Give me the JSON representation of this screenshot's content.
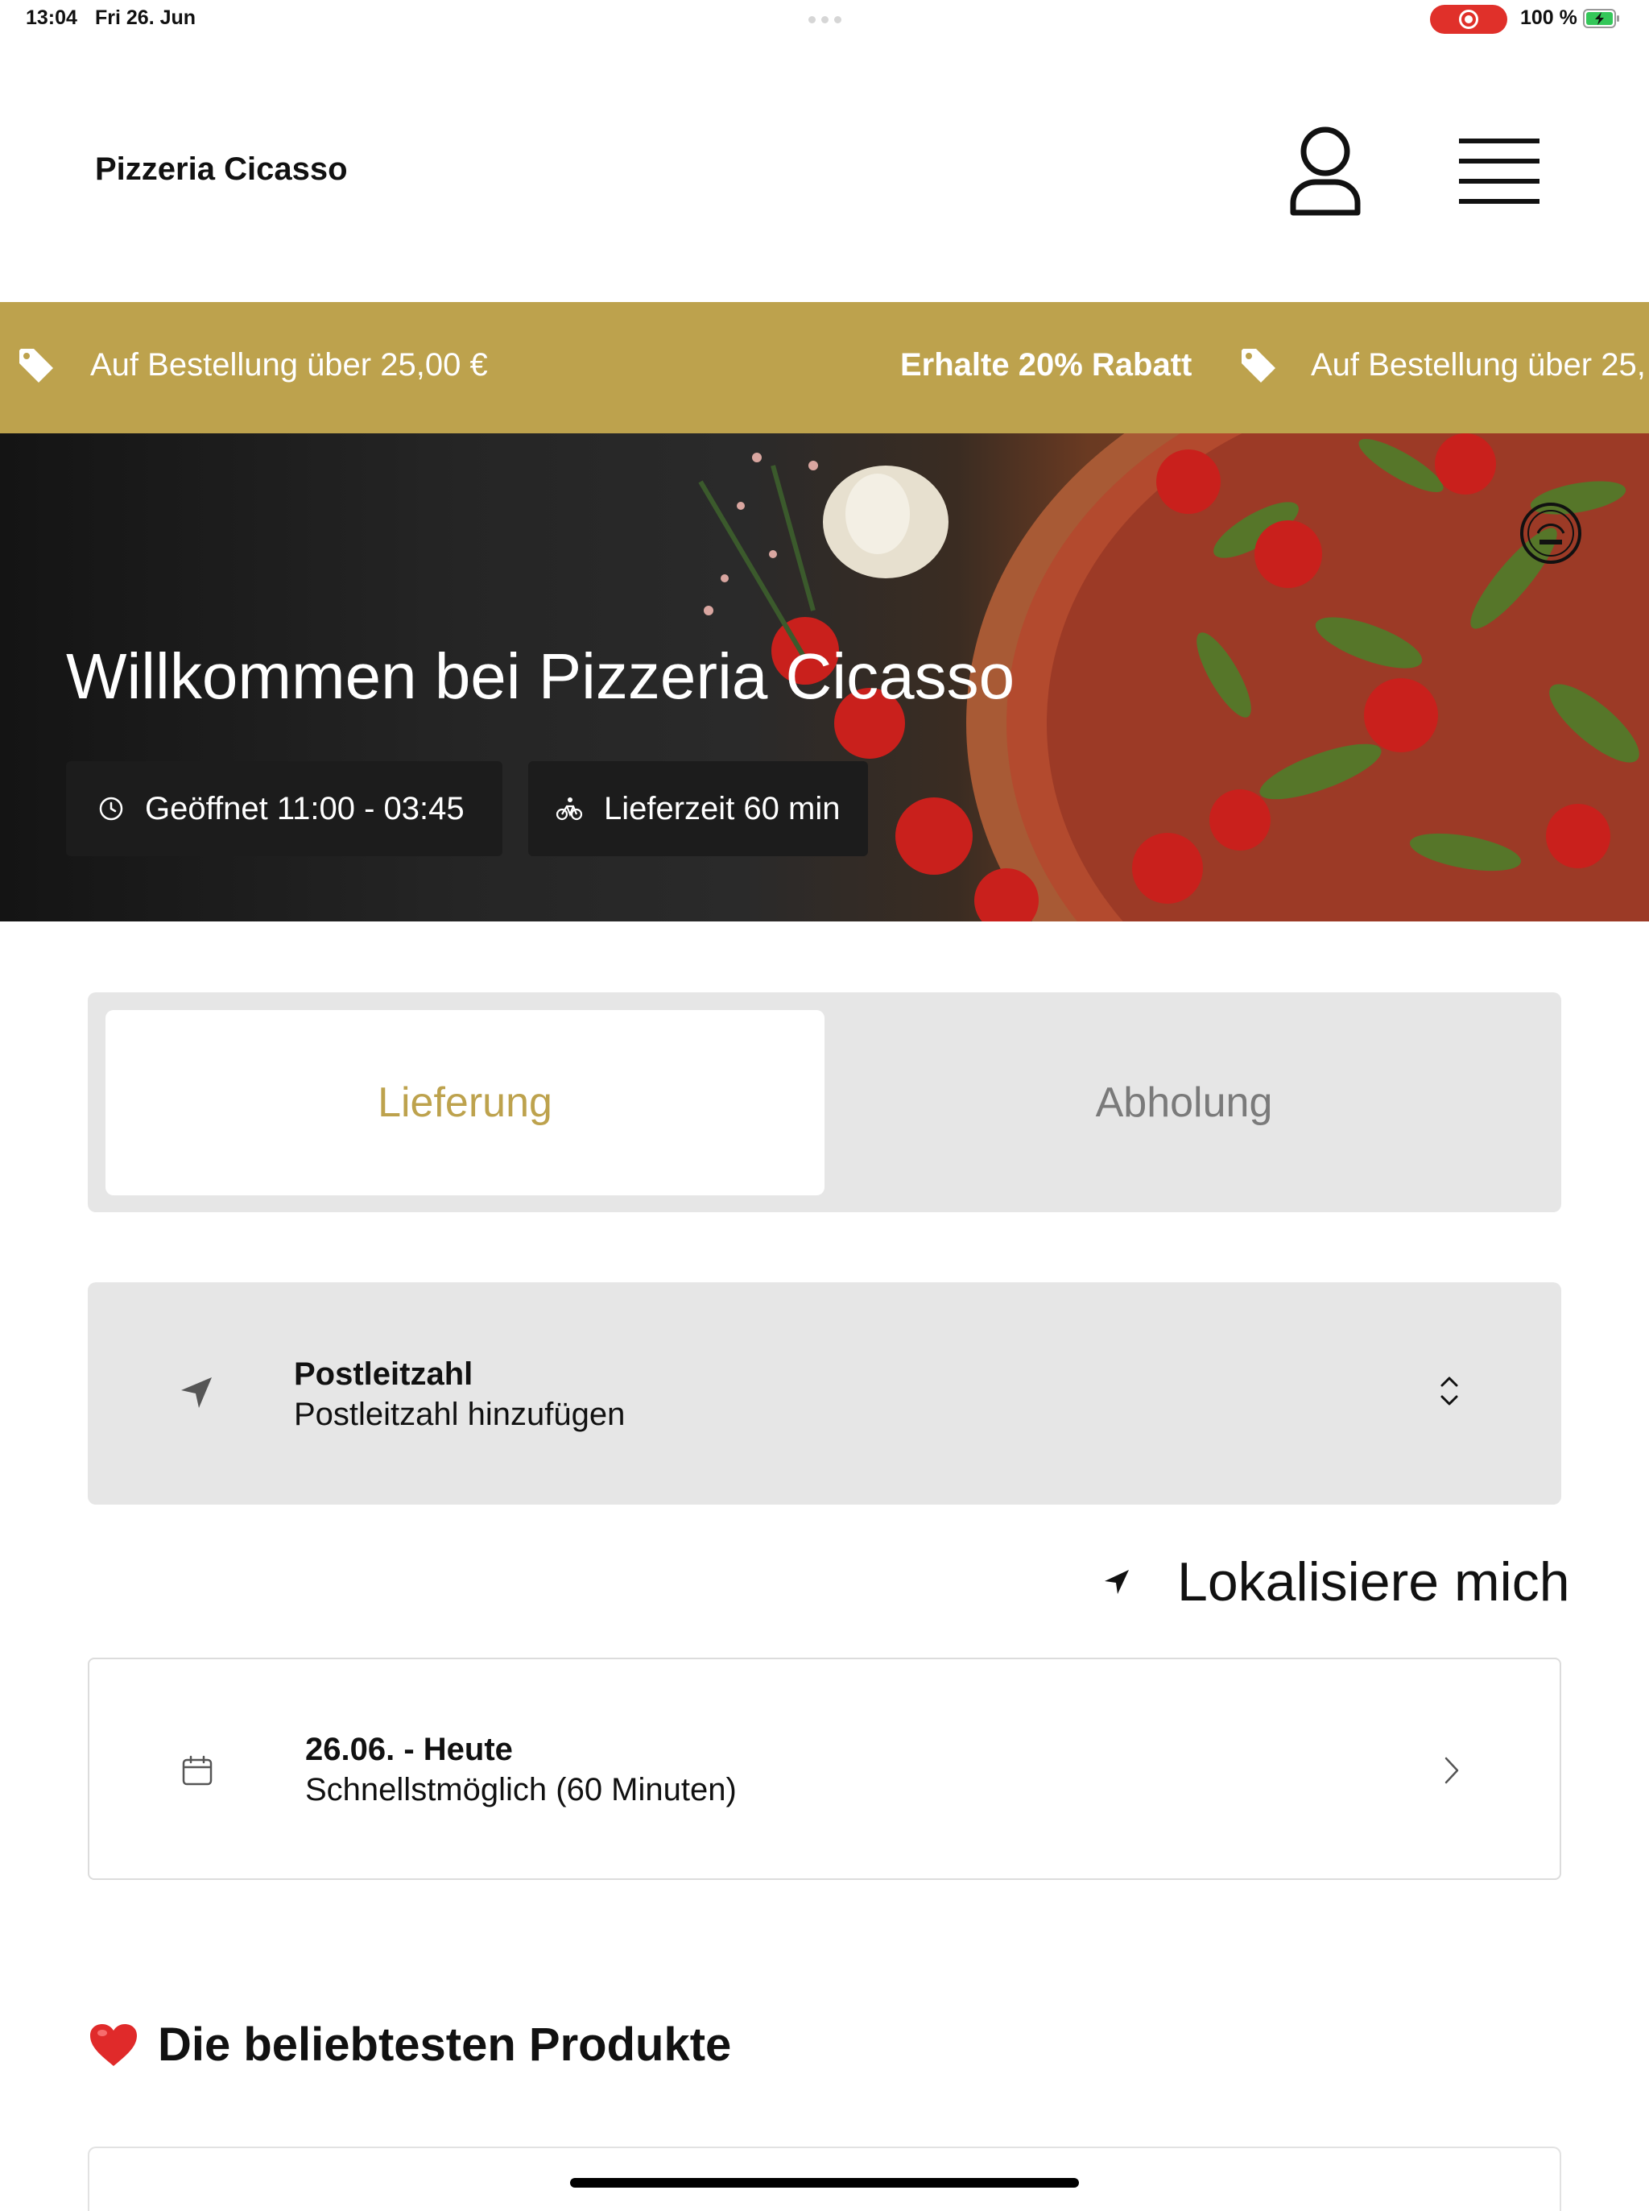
{
  "status_bar": {
    "time": "13:04",
    "date": "Fri 26. Jun",
    "battery": "100 %",
    "recording_color": "#e0302a"
  },
  "header": {
    "brand": "Pizzeria Cicasso",
    "user_icon": "user-icon",
    "menu_icon": "hamburger-menu-icon"
  },
  "promo": {
    "background": "#bda24d",
    "text_1": "Auf Bestellung über 25,00 €",
    "text_2": "Erhalte 20% Rabatt",
    "text_3": "Auf Bestellung über 25,"
  },
  "hero": {
    "title": "Willkommen bei Pizzeria Cicasso",
    "open_hours": "Geöffnet 11:00 - 03:45",
    "delivery_time": "Lieferzeit 60 min"
  },
  "order_mode": {
    "tabs": [
      {
        "label": "Lieferung",
        "active": true
      },
      {
        "label": "Abholung",
        "active": false
      }
    ],
    "accent": "#bda24d"
  },
  "postcode": {
    "label": "Postleitzahl",
    "value": "Postleitzahl hinzufügen"
  },
  "locate": {
    "label": "Lokalisiere mich"
  },
  "delivery_date": {
    "label": "26.06. - Heute",
    "value": "Schnellstmöglich (60 Minuten)"
  },
  "popular": {
    "title": "Die beliebtesten Produkte"
  }
}
